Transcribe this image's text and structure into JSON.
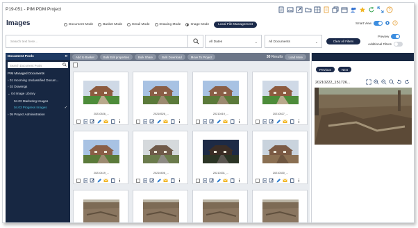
{
  "window_title": "P19-051 - PIM PDM Project",
  "page_heading": "Images",
  "modes": [
    {
      "label": "Document Mode",
      "selected": false
    },
    {
      "label": "Basket Mode",
      "selected": false
    },
    {
      "label": "Email Mode",
      "selected": false
    },
    {
      "label": "Drawing Mode",
      "selected": false
    },
    {
      "label": "Image Mode",
      "selected": true
    }
  ],
  "local_file_mgmt_label": "Local File Management",
  "smart_view_label": "Smart View",
  "search": {
    "placeholder": "Search text here..."
  },
  "filters": {
    "dates": "All Dates",
    "documents": "All Documents",
    "clear_label": "Clear All Filters"
  },
  "preview_label": "Preview",
  "additional_filters_label": "Additional Filters",
  "sidebar": {
    "title": "Document Pools",
    "search_placeholder": "Search Document Pools",
    "section": "PIM Managed Documents",
    "items": [
      {
        "label": "01 Incoming Unclassified Docum...",
        "expanded": false
      },
      {
        "label": "02 Drawings",
        "expanded": false
      },
      {
        "label": "04 Image Library",
        "expanded": true
      },
      {
        "label": "04.02 Marketing Images"
      },
      {
        "label": "04.03 Progress Images",
        "active": true
      },
      {
        "label": "05 Project Administration",
        "expanded": false
      }
    ]
  },
  "toolbar": {
    "buttons": [
      "Add to Basket",
      "Bulk Edit properties",
      "Bulk Share",
      "Bulk Download",
      "Move To Project"
    ],
    "results_count": "30",
    "results_label": "Results",
    "load_more_label": "Load More"
  },
  "cards": [
    {
      "name": "20210526_...",
      "scene": "lawn"
    },
    {
      "name": "20210526_...",
      "scene": "house"
    },
    {
      "name": "20210419_...",
      "scene": "house"
    },
    {
      "name": "20210527_...",
      "scene": "lawn"
    },
    {
      "name": "20210419_...",
      "scene": "house"
    },
    {
      "name": "20210406_...",
      "scene": "path"
    },
    {
      "name": "20210331_...",
      "scene": "night"
    },
    {
      "name": "20210330_...",
      "scene": "dirt"
    },
    {
      "name": "",
      "scene": "site"
    },
    {
      "name": "",
      "scene": "site"
    },
    {
      "name": "",
      "scene": "site"
    },
    {
      "name": "",
      "scene": "site"
    }
  ],
  "preview": {
    "previous_label": "Previous",
    "next_label": "Next",
    "filename": "20210222_151726..."
  }
}
